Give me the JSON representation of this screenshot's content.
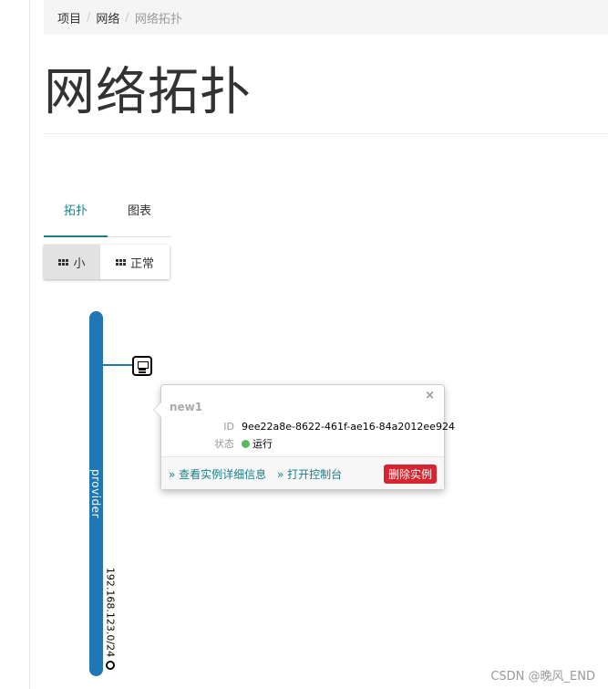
{
  "breadcrumb": {
    "items": [
      "项目",
      "网络",
      "网络拓扑"
    ],
    "separator": "/"
  },
  "page": {
    "title": "网络拓扑"
  },
  "tabs": [
    {
      "label": "拓扑",
      "active": true
    },
    {
      "label": "图表",
      "active": false
    }
  ],
  "size_buttons": [
    {
      "label": "小",
      "active": true
    },
    {
      "label": "正常",
      "active": false
    }
  ],
  "network": {
    "name": "provider",
    "cidr": "192.168.123.0/24",
    "color": "#2177b4"
  },
  "instance_popover": {
    "name": "new1",
    "close_symbol": "×",
    "id_label": "ID",
    "id_value": "9ee22a8e-8622-461f-ae16-84a2012ee924",
    "status_label": "状态",
    "status_value": "运行",
    "status_color": "#5cb85c",
    "link_details": "» 查看实例详细信息",
    "link_console": "» 打开控制台",
    "delete_label": "删除实例",
    "delete_color": "#d9232e"
  },
  "watermark": "CSDN @晚风_END",
  "colors": {
    "accent": "#1a7f86"
  }
}
